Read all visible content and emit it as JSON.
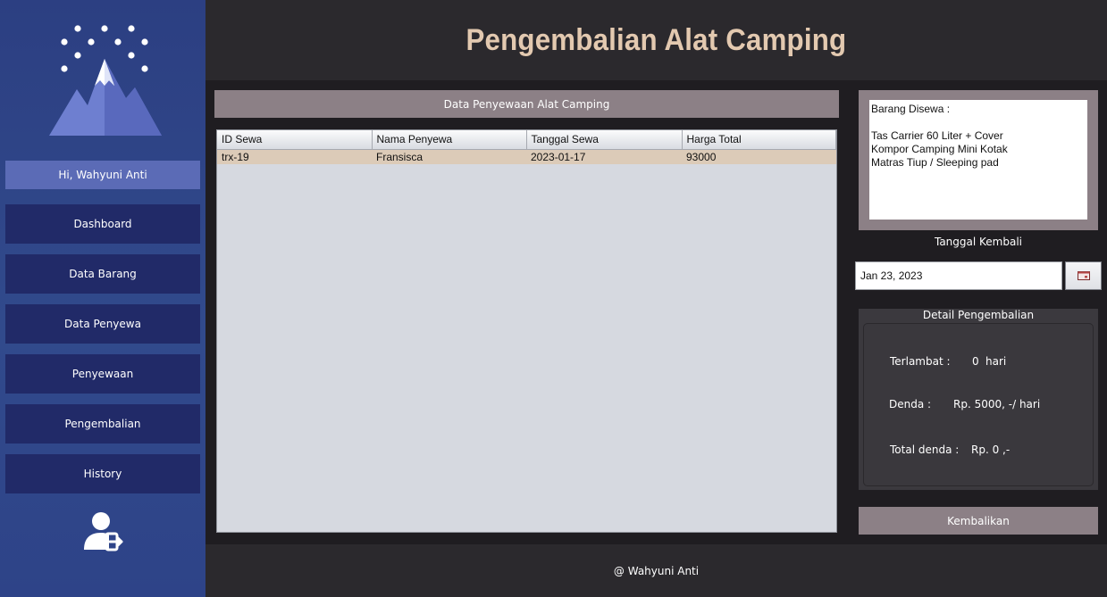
{
  "app": {
    "title": "Pengembalian Alat Camping"
  },
  "sidebar": {
    "greeting": "Hi, Wahyuni Anti",
    "items": [
      {
        "label": "Dashboard"
      },
      {
        "label": "Data Barang"
      },
      {
        "label": "Data Penyewa"
      },
      {
        "label": "Penyewaan"
      },
      {
        "label": "Pengembalian"
      },
      {
        "label": "History"
      }
    ],
    "logo_icon": "mountain-snow-logo",
    "logout_icon": "user-logout-icon"
  },
  "rental_table": {
    "title": "Data Penyewaan Alat Camping",
    "columns": [
      "ID Sewa",
      "Nama Penyewa",
      "Tanggal Sewa",
      "Harga Total"
    ],
    "rows": [
      [
        "trx-19",
        "Fransisca",
        "2023-01-17",
        "93000"
      ]
    ],
    "selected_row_color": "#dccbb8"
  },
  "rented_items": {
    "text": "Barang Disewa :\n\nTas Carrier 60 Liter + Cover\nKompor Camping Mini Kotak\nMatras Tiup / Sleeping pad"
  },
  "return_date": {
    "label": "Tanggal Kembali",
    "value": "Jan 23, 2023",
    "calendar_icon": "calendar-icon"
  },
  "detail": {
    "title": "Detail Pengembalian",
    "late_label": "Terlambat :",
    "late_value": "0",
    "late_unit": "hari",
    "fine_label": "Denda :",
    "fine_value": "Rp. 5000, -/ hari",
    "total_label": "Total denda :",
    "total_value": "Rp. 0 ,-"
  },
  "actions": {
    "return_label": "Kembalikan"
  },
  "footer": {
    "text": "@ Wahyuni Anti"
  },
  "colors": {
    "sidebar": "#2e4388",
    "nav_button": "#212a68",
    "greeting_bg": "#5b6bb6",
    "title_text": "#e3c9b0",
    "panel_accent": "#8c8086"
  }
}
